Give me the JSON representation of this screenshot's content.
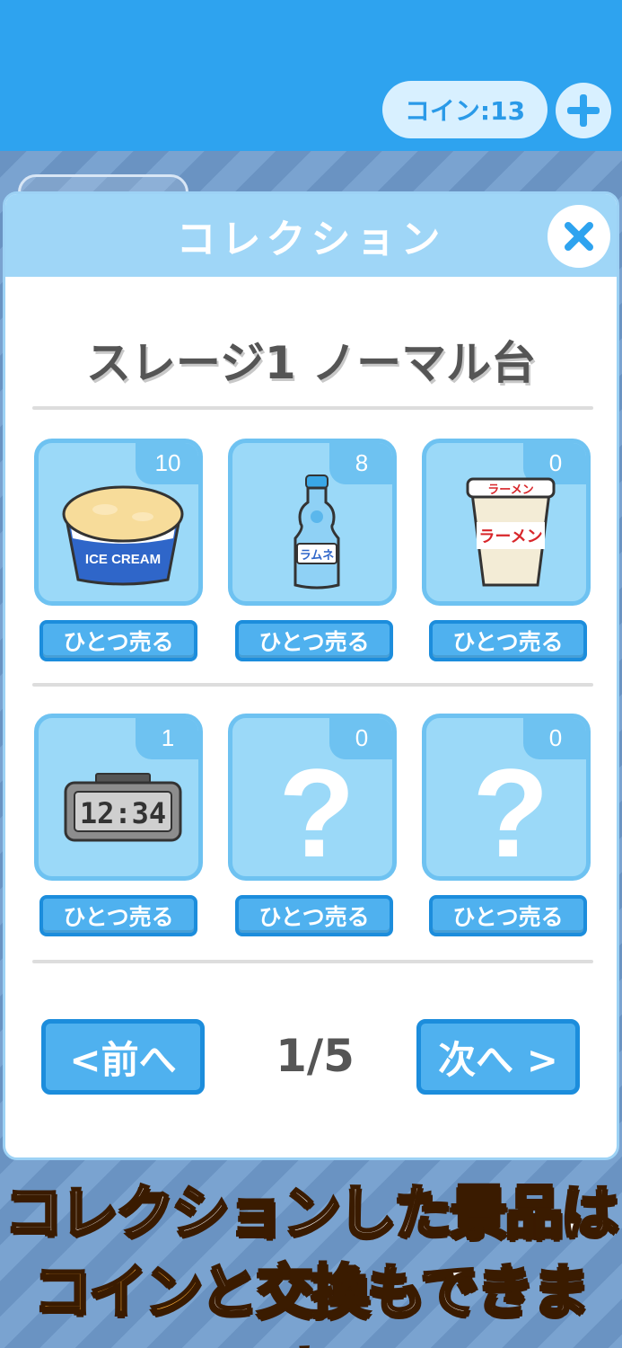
{
  "header": {
    "coin_label": "コイン:13",
    "add_icon": "plus-icon"
  },
  "modal": {
    "title": "コレクション",
    "close_icon": "close-icon",
    "stage_title": "スレージ1 ノーマル台",
    "items": [
      {
        "count": "10",
        "sell_label": "ひとつ売る",
        "icon": "ice-cream-icon",
        "img_text": "ICE CREAM"
      },
      {
        "count": "8",
        "sell_label": "ひとつ売る",
        "icon": "ramune-bottle-icon",
        "img_text": "ラムネ"
      },
      {
        "count": "0",
        "sell_label": "ひとつ売る",
        "icon": "cup-ramen-icon",
        "img_text": "ラーメン",
        "img_text2": "ラーメン"
      },
      {
        "count": "1",
        "sell_label": "ひとつ売る",
        "icon": "digital-clock-icon",
        "img_text": "12:34"
      },
      {
        "count": "0",
        "sell_label": "ひとつ売る",
        "icon": "question-mark-icon",
        "img_text": "?"
      },
      {
        "count": "0",
        "sell_label": "ひとつ売る",
        "icon": "question-mark-icon",
        "img_text": "?"
      }
    ],
    "prev_label": "<前へ",
    "next_label": "次へ >",
    "page_indicator": "1/5"
  },
  "banner": {
    "line1_a": "コレクションした",
    "line1_b": "景品",
    "line1_c": "は",
    "line2_a": "コイン",
    "line2_b": "と",
    "line2_c": "交換",
    "line2_d": "もできます!"
  },
  "colors": {
    "top_bar": "#2ea3ef",
    "tile": "#9bd9f8",
    "button": "#4fb1ef",
    "banner_accent": "#ffb13b"
  }
}
